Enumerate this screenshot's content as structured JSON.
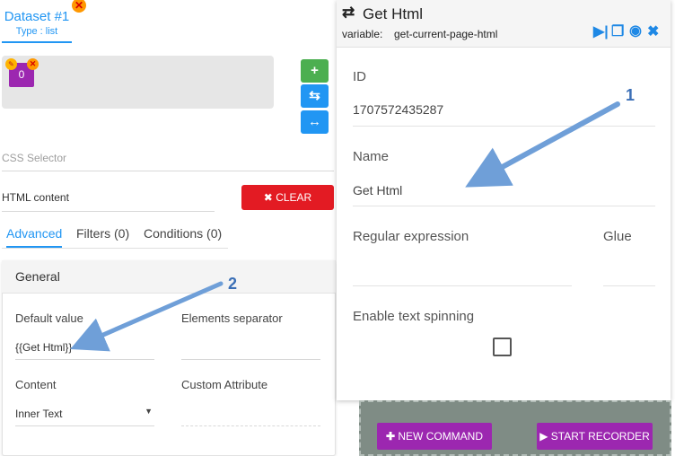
{
  "dataset": {
    "title": "Dataset #1",
    "type": "Type : list",
    "item_value": "0"
  },
  "side_buttons": {
    "add": "+",
    "refresh": "⇆",
    "expand": "↔"
  },
  "css_selector": {
    "placeholder": "CSS Selector"
  },
  "html_content": {
    "label": "HTML content"
  },
  "clear_button": {
    "icon": "✖",
    "label": "CLEAR"
  },
  "tabs": [
    {
      "label": "Advanced"
    },
    {
      "label": "Filters (0)"
    },
    {
      "label": "Conditions (0)"
    }
  ],
  "general": {
    "title": "General",
    "default_value_label": "Default value",
    "default_value": "{{Get Html}}",
    "elements_separator_label": "Elements separator",
    "content_label": "Content",
    "content_value": "Inner Text",
    "custom_attribute_label": "Custom Attribute"
  },
  "command": {
    "title": "Get Html",
    "variable_prefix": "variable:",
    "variable": "get-current-page-html",
    "id_label": "ID",
    "id_value": "1707572435287",
    "name_label": "Name",
    "name_value": "Get Html",
    "regex_label": "Regular expression",
    "glue_label": "Glue",
    "spinning_label": "Enable text spinning"
  },
  "bottom_buttons": {
    "new_command": "NEW COMMAND",
    "start_recorder": "START RECORDER"
  },
  "annotations": {
    "arrow_1": "1",
    "arrow_2": "2"
  },
  "colors": {
    "accent_blue": "#2196f3",
    "clear_red": "#e31b23",
    "purple": "#9c27b0",
    "green": "#4caf50",
    "arrow": "#6f9fd8"
  }
}
